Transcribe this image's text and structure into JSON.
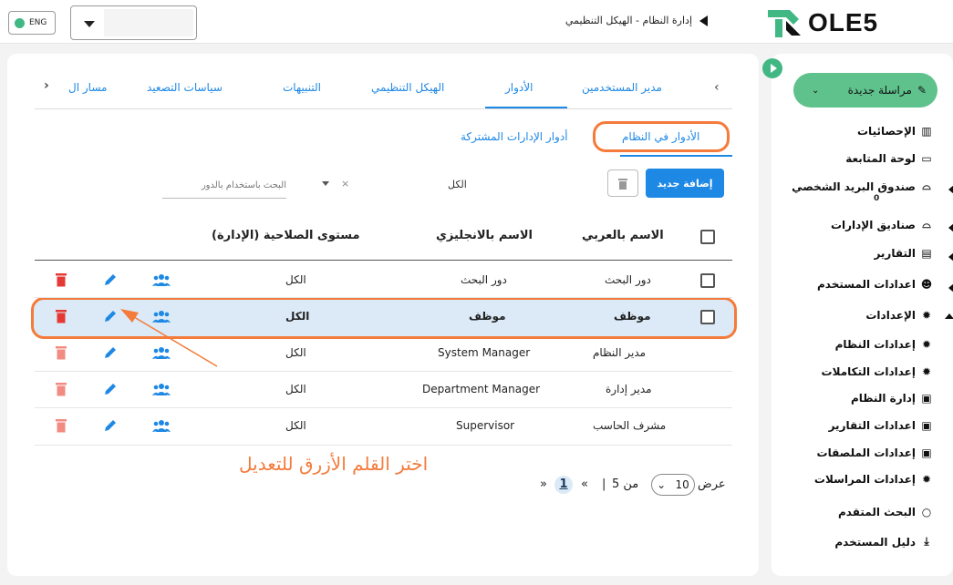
{
  "header": {
    "lang": "ENG",
    "breadcrumb": "إدارة النظام - الهيكل التنظيمي",
    "logo": "OLE5"
  },
  "tabs": [
    "مدير المستخدمين",
    "الأدوار",
    "الهيكل التنظيمي",
    "التنبيهات",
    "سياسات التصعيد",
    "مسار ال"
  ],
  "subtabs": {
    "system_roles": "الأدوار في النظام",
    "shared_roles": "أدوار الإدارات المشتركة"
  },
  "toolbar": {
    "new_button": "إضافة جديد",
    "filter_value": "الكل",
    "filter_clear": "×",
    "search_placeholder": "البحث باستخدام  بالدور"
  },
  "table": {
    "headers": {
      "arabic": "الاسم بالعربي",
      "english": "الاسم بالانجليزي",
      "permission": "مستوى الصلاحية (الإدارة)"
    },
    "rows": [
      {
        "ar": "دور البحث",
        "en": "دور البحث",
        "perm": "الكل"
      },
      {
        "ar": "موظف",
        "en": "موظف",
        "perm": "الكل"
      },
      {
        "ar": "مدير النظام",
        "en": "System Manager",
        "perm": "الكل"
      },
      {
        "ar": "مدير إدارة",
        "en": "Department Manager",
        "perm": "الكل"
      },
      {
        "ar": "مشرف الحاسب",
        "en": "Supervisor",
        "perm": "الكل"
      }
    ]
  },
  "pagination": {
    "show_label": "عرض",
    "page_size": "10",
    "of_label": "من 5",
    "separator": "|",
    "first": "«",
    "current": "1",
    "last": "»"
  },
  "annotation": "اختر القلم الأزرق للتعديل",
  "sidebar": {
    "new_message": "مراسلة جديدة",
    "items": [
      {
        "label": "الإحصائيات",
        "icon": "chart-icon"
      },
      {
        "label": "لوحة المتابعة",
        "icon": "dashboard-icon"
      },
      {
        "label": "صندوق البريد الشخصي",
        "icon": "inbox-icon",
        "badge": "0"
      },
      {
        "label": "صناديق الإدارات",
        "icon": "inbox-icon"
      },
      {
        "label": "التقارير",
        "icon": "document-icon"
      },
      {
        "label": "اعدادات المستخدم",
        "icon": "user-settings-icon"
      },
      {
        "label": "الإعدادات",
        "icon": "gear-icon"
      },
      {
        "label": "إعدادات النظام",
        "icon": "gear-icon"
      },
      {
        "label": "إعدادات التكاملات",
        "icon": "gear-icon"
      },
      {
        "label": "إدارة النظام",
        "icon": "list-icon"
      },
      {
        "label": "اعدادات التقارير",
        "icon": "list-icon"
      },
      {
        "label": "إعدادات الملصقات",
        "icon": "list-icon"
      },
      {
        "label": "إعدادات المراسلات",
        "icon": "gear-icon"
      },
      {
        "label": "البحث المتقدم",
        "icon": "search-icon"
      },
      {
        "label": "دليل المستخدم",
        "icon": "download-icon"
      }
    ]
  },
  "colors": {
    "accent": "#1e88e5",
    "brand": "#41b883",
    "highlight": "#f47b3b",
    "danger": "#e53935"
  }
}
